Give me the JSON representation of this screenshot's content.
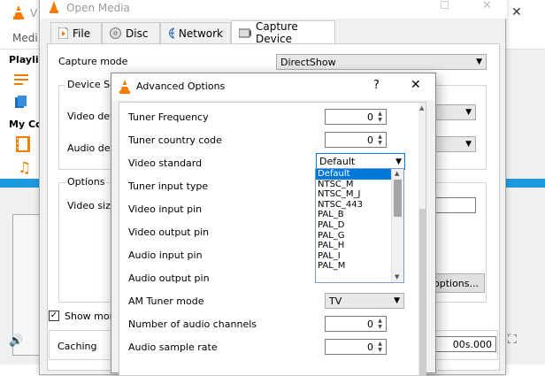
{
  "vlc": {
    "title_partial": "V",
    "menu_partial": "Medi",
    "sidebar": {
      "playlist": "Playlis",
      "my_computer": "My Co"
    },
    "icons": [
      "vlc-cone-icon",
      "playlist-icon",
      "media-icon",
      "video-icon",
      "music-icon",
      "picture-icon",
      "volume-icon",
      "fullscreen-icon"
    ]
  },
  "open_media": {
    "title": "Open Media",
    "tabs": [
      {
        "label": "File",
        "icon": "file-icon"
      },
      {
        "label": "Disc",
        "icon": "disc-icon"
      },
      {
        "label": "Network",
        "icon": "network-icon"
      },
      {
        "label": "Capture Device",
        "icon": "capture-device-icon"
      }
    ],
    "capture_mode": {
      "label": "Capture mode",
      "value": "DirectShow"
    },
    "device_selection": "Device Se",
    "video_device": "Video dev",
    "audio_device": "Audio dev",
    "options": "Options",
    "video_size": "Video size",
    "advanced_button": "options...",
    "show_more": "Show more",
    "show_more_checked": true,
    "caching": {
      "label": "Caching",
      "value": "00s.000"
    }
  },
  "advanced": {
    "title": "Advanced Options",
    "help": "?",
    "close": "✕",
    "rows": [
      {
        "label": "Tuner Frequency",
        "value": "0",
        "type": "spin"
      },
      {
        "label": "Tuner country code",
        "value": "0",
        "type": "spin"
      },
      {
        "label": "Video standard",
        "value": "Default",
        "type": "combo-open"
      },
      {
        "label": "Tuner input type",
        "value": "",
        "type": "hidden"
      },
      {
        "label": "Video input pin",
        "value": "",
        "type": "hidden"
      },
      {
        "label": "Video output pin",
        "value": "",
        "type": "hidden"
      },
      {
        "label": "Audio input pin",
        "value": "",
        "type": "hidden"
      },
      {
        "label": "Audio output pin",
        "value": "",
        "type": "hidden"
      },
      {
        "label": "AM Tuner mode",
        "value": "TV",
        "type": "combo"
      },
      {
        "label": "Number of audio channels",
        "value": "0",
        "type": "spin"
      },
      {
        "label": "Audio sample rate",
        "value": "0",
        "type": "spin"
      }
    ],
    "video_standard_options": [
      "Default",
      "NTSC_M",
      "NTSC_M_J",
      "NTSC_443",
      "PAL_B",
      "PAL_D",
      "PAL_G",
      "PAL_H",
      "PAL_I",
      "PAL_M"
    ]
  }
}
